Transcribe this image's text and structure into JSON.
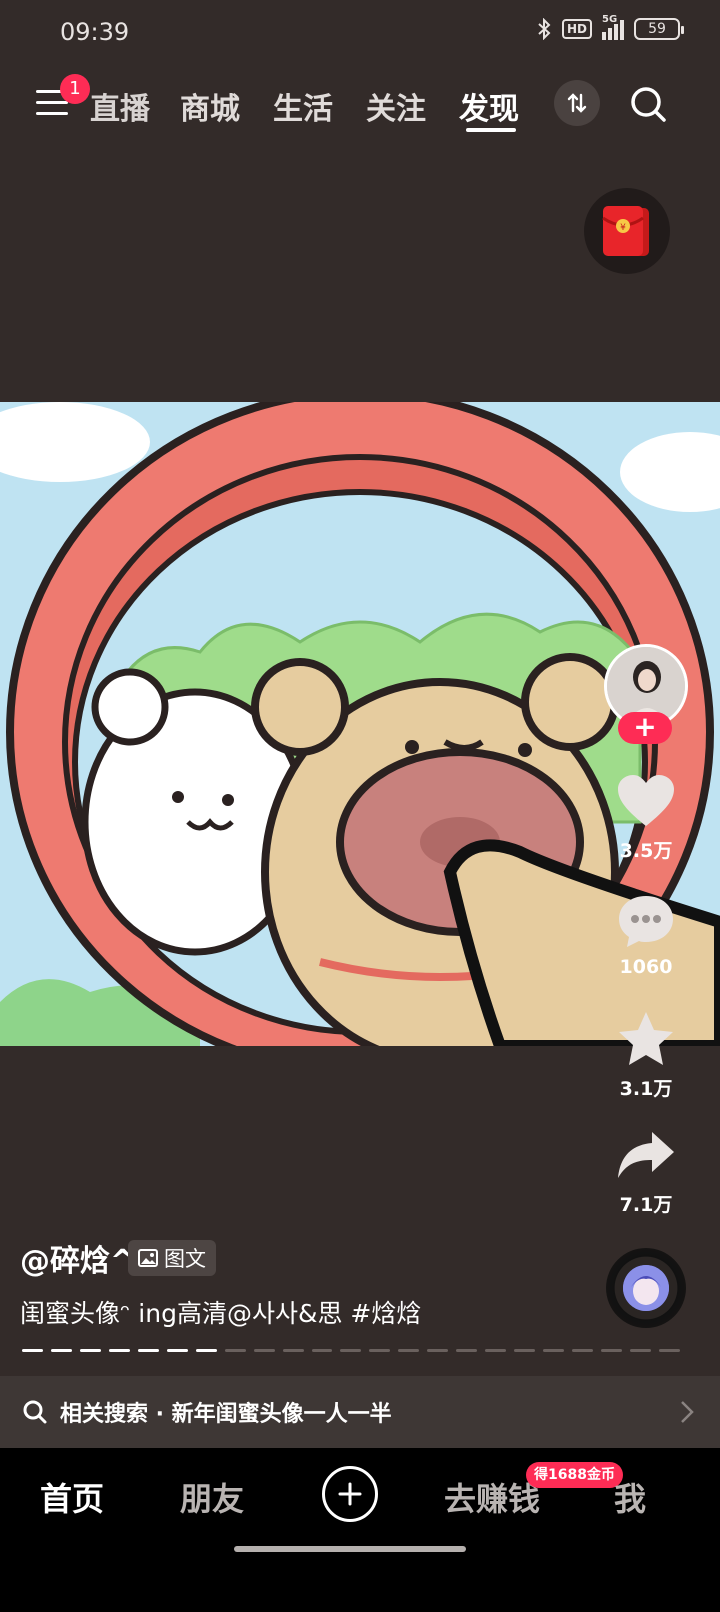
{
  "status_bar": {
    "time": "09:39",
    "network": "5G",
    "hd": "HD",
    "battery": "59"
  },
  "top_nav": {
    "menu_badge": "1",
    "tabs": [
      {
        "label": "直播",
        "active": false
      },
      {
        "label": "商城",
        "active": false
      },
      {
        "label": "生活",
        "active": false
      },
      {
        "label": "关注",
        "active": false
      },
      {
        "label": "发现",
        "active": true
      }
    ]
  },
  "post": {
    "author": "@碎焓^",
    "type_tag": "图文",
    "description": "闺蜜头像ᵔ ing高清@사사&思 #焓焓",
    "stats": {
      "likes": "3.5万",
      "comments": "1060",
      "favorites": "3.1万",
      "shares": "7.1万"
    },
    "progress": {
      "total": 23,
      "viewed": 7
    }
  },
  "related_search": {
    "label": "相关搜索 · 新年闺蜜头像一人一半"
  },
  "bottom_tabs": [
    {
      "label": "首页",
      "active": true
    },
    {
      "label": "朋友",
      "active": false
    },
    {
      "label": "去赚钱",
      "active": false
    },
    {
      "label": "我",
      "active": false
    }
  ],
  "earn_badge": "得1688金币",
  "colors": {
    "accent": "#fe2c55",
    "background": "#332b29"
  }
}
